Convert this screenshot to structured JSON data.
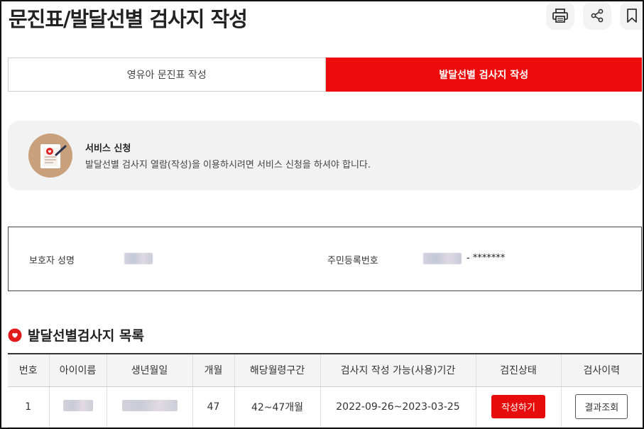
{
  "header": {
    "title": "문진표/발달선별 검사지 작성",
    "icons": [
      "print-icon",
      "share-icon",
      "bookmark-icon"
    ]
  },
  "tabs": [
    {
      "label": "영유아 문진표 작성",
      "active": false
    },
    {
      "label": "발달선별 검사지 작성",
      "active": true
    }
  ],
  "service": {
    "title": "서비스 신청",
    "description": "발달선별 검사지 열람(작성)을 이용하시려면 서비스 신청을 하셔야 합니다."
  },
  "guardian": {
    "name_label": "보호자 성명",
    "rrn_label": "주민등록번호",
    "rrn_masked": "- *******"
  },
  "list": {
    "title": "발달선별검사지 목록",
    "columns": [
      "번호",
      "아이이름",
      "생년월일",
      "개월",
      "해당월령구간",
      "검사지 작성 가능(사용)기간",
      "검진상태",
      "검사이력"
    ],
    "rows": [
      {
        "no": "1",
        "months": "47",
        "range": "42~47개월",
        "period": "2022-09-26~2023-03-25",
        "status_button": "작성하기",
        "history_button": "결과조회"
      }
    ]
  },
  "colors": {
    "accent": "#ee0b0b",
    "panel": "#f2f2f2"
  }
}
